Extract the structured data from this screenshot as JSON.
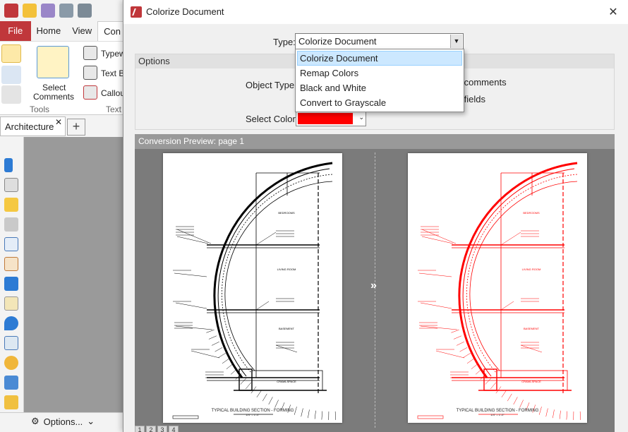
{
  "app": {
    "ribbon_tabs": [
      "File",
      "Home",
      "View",
      "Con"
    ],
    "ribbon": {
      "tools_group": "Tools",
      "text_group": "Text",
      "select_comments_line1": "Select",
      "select_comments_line2": "Comments",
      "typewriter": "Typew",
      "text_box": "Text B",
      "callout": "Callou"
    },
    "doc_tab": "Architecture",
    "options_label": "Options..."
  },
  "dialog": {
    "title": "Colorize Document",
    "type_label": "Type:",
    "type_value": "Colorize Document",
    "type_options": [
      "Colorize Document",
      "Remap Colors",
      "Black and White",
      "Convert to Grayscale"
    ],
    "options_title": "Options",
    "object_type_label": "Object Type:",
    "comments_text": "ss comments",
    "fields_text": "ss fields",
    "select_color_label": "Select Color:",
    "selected_color": "#ff0000",
    "preview_title": "Conversion Preview: page 1",
    "page_numbers": [
      "1",
      "2",
      "3",
      "4"
    ]
  },
  "drawing": {
    "labels": [
      "BEDROOMS",
      "LIVING ROOM",
      "BASEMENT",
      "CRAWLSPACE"
    ],
    "caption": "TYPICAL BUILDING SECTION - FORMING",
    "caption_sub": "1/4\" = 1'-0\""
  },
  "colors": {
    "accent": "#c0373b",
    "original_ink": "#000000",
    "colorized_ink": "#ff0000"
  }
}
